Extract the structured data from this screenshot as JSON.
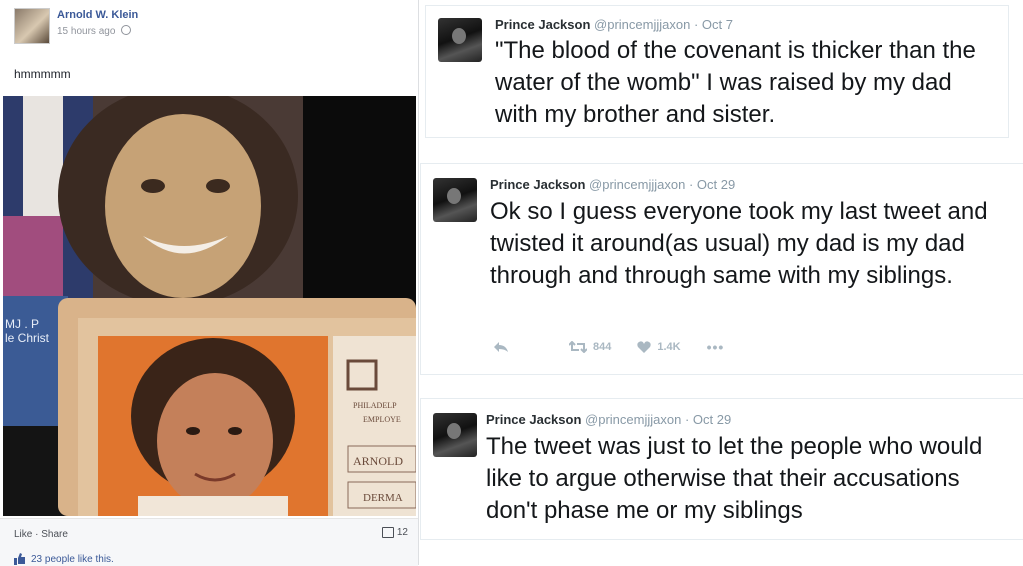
{
  "facebook_post": {
    "author": "Arnold W. Klein",
    "time": "15 hours ago",
    "text": "hmmmmm",
    "photo": {
      "label_left_1": "MJ . P",
      "label_left_2": "le Christ",
      "card_label_1": "PHILADELP",
      "card_label_2": "EMPLOYE",
      "card_label_3": "ARNOLD",
      "card_label_4": "DERMA"
    },
    "like_label": "Like",
    "separator": "·",
    "share_label": "Share",
    "comment_count": "12",
    "likes_text": "23 people like this."
  },
  "tweets": [
    {
      "name": "Prince Jackson",
      "handle": "@princemjjjaxon",
      "date": "· Oct 7",
      "text": "\"The blood of the covenant is thicker than the water of the womb\" I was raised by my dad with my brother and sister."
    },
    {
      "name": "Prince Jackson",
      "handle": "@princemjjjaxon",
      "date": "· Oct 29",
      "text": "Ok so I guess everyone took my last tweet and twisted it around(as usual) my dad is my dad through and through same with my siblings.",
      "retweets": "844",
      "likes": "1.4K"
    },
    {
      "name": "Prince Jackson",
      "handle": "@princemjjjaxon",
      "date": "· Oct 29",
      "text": "The tweet was just to let the people who would like to argue otherwise that their accusations don't phase me or my siblings"
    }
  ],
  "colors": {
    "fb_link": "#3b5998",
    "tw_text": "#14171a",
    "tw_muted": "#8899a6"
  }
}
